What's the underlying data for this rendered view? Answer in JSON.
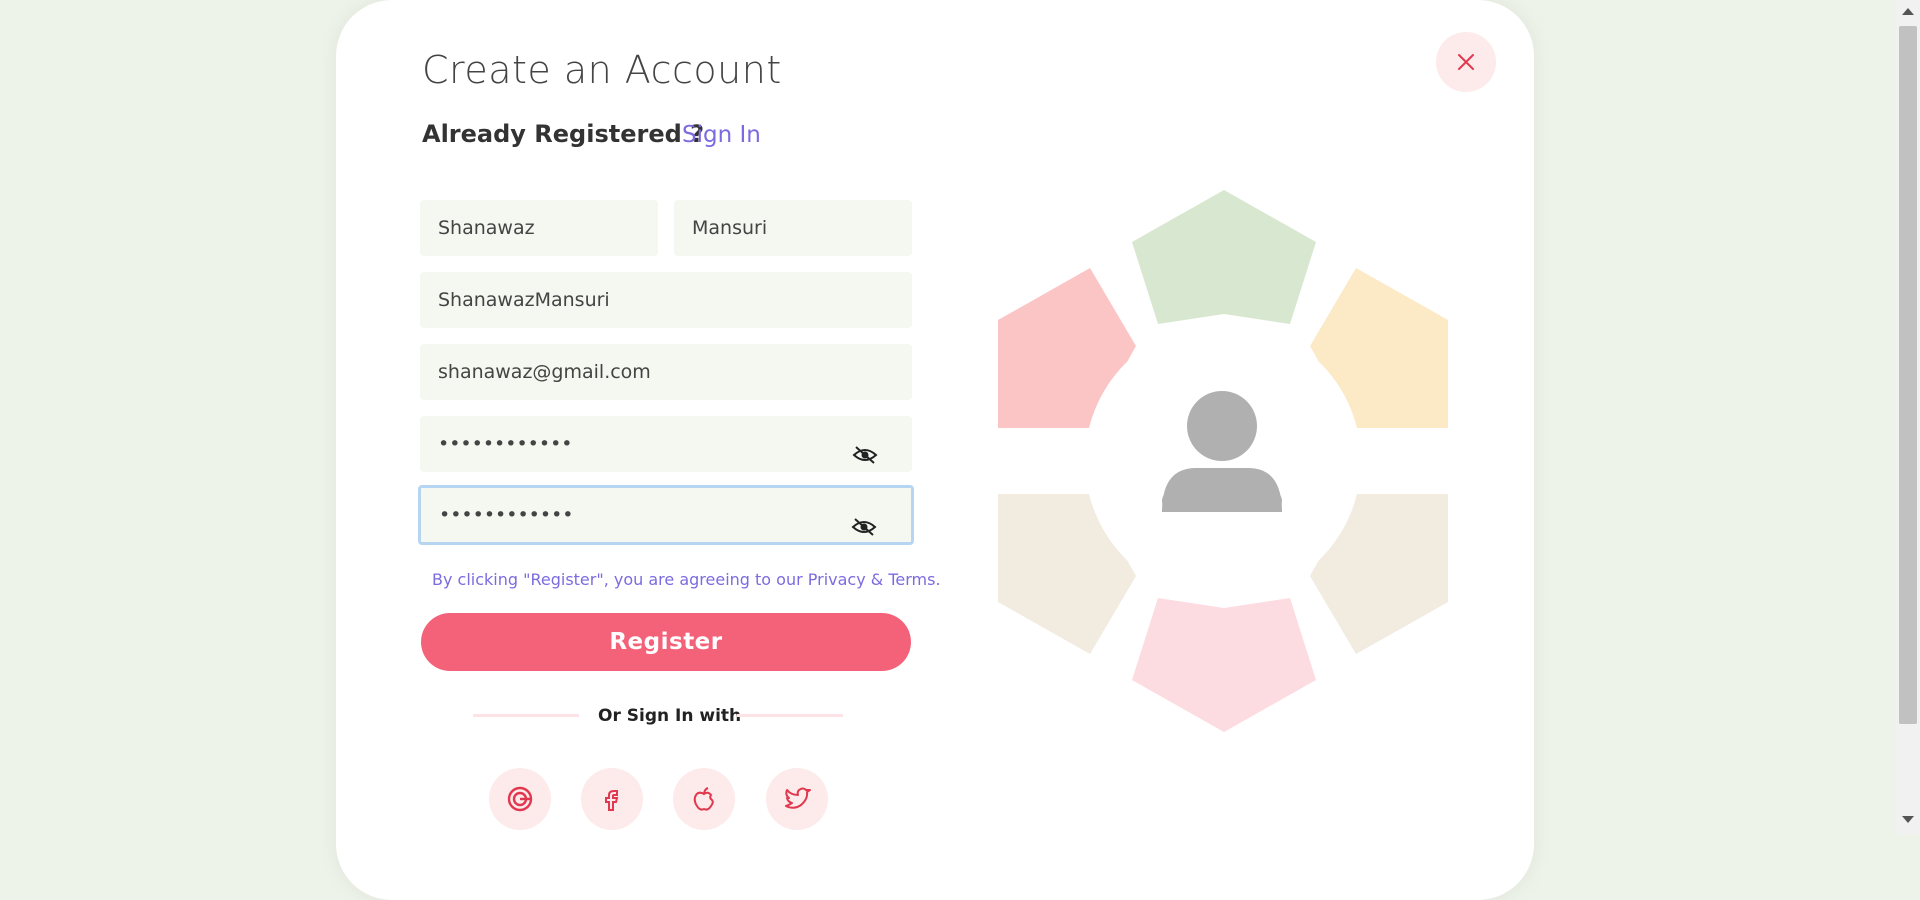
{
  "modal": {
    "title": "Create an Account",
    "already_text": "Already Registered ?",
    "signin_label": "Sign In",
    "close_icon": "close-icon"
  },
  "form": {
    "first_name": "Shanawaz",
    "last_name": "Mansuri",
    "username": "ShanawazMansuri",
    "email": "shanawaz@gmail.com",
    "password": "••••••••••••",
    "confirm_password": "••••••••••••",
    "terms_text": "By clicking \"Register\", you are agreeing to our Privacy & Terms.",
    "register_label": "Register",
    "or_text": "Or Sign In with"
  },
  "social": [
    "google-icon",
    "facebook-icon",
    "apple-icon",
    "twitter-icon"
  ],
  "colors": {
    "accent": "#f4627a",
    "link": "#7c6be0",
    "field_bg": "#f4f8f1",
    "page_bg": "#eef3ea"
  }
}
